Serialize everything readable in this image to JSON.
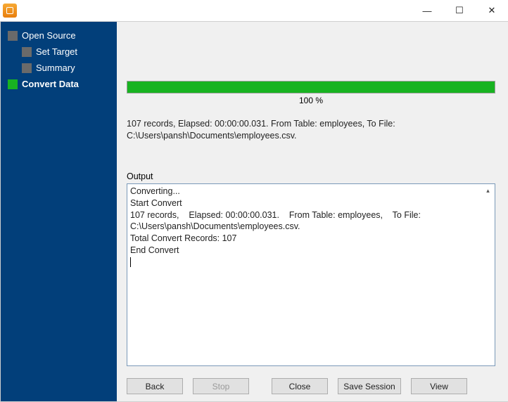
{
  "window": {
    "minimize": "—",
    "maximize": "☐",
    "close": "✕"
  },
  "sidebar": {
    "items": [
      {
        "label": "Open Source",
        "active": false,
        "indent": false
      },
      {
        "label": "Set Target",
        "active": false,
        "indent": true
      },
      {
        "label": "Summary",
        "active": false,
        "indent": true
      },
      {
        "label": "Convert Data",
        "active": true,
        "indent": false
      }
    ]
  },
  "progress": {
    "percent_value": 100,
    "percent_text": "100 %"
  },
  "summary": "107 records,    Elapsed: 00:00:00.031.    From Table: employees,    To File: C:\\Users\\pansh\\Documents\\employees.csv.",
  "output": {
    "label": "Output",
    "text": "Converting...\nStart Convert\n107 records,    Elapsed: 00:00:00.031.    From Table: employees,    To File: C:\\Users\\pansh\\Documents\\employees.csv.\nTotal Convert Records: 107\nEnd Convert"
  },
  "buttons": {
    "back": "Back",
    "stop": "Stop",
    "close": "Close",
    "save_session": "Save Session",
    "view": "View"
  }
}
